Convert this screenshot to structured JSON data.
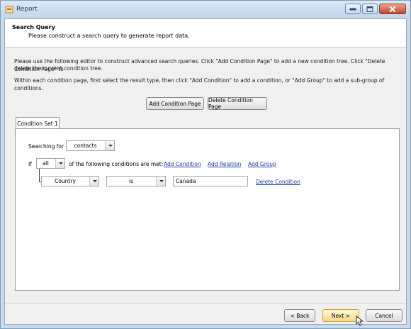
{
  "window": {
    "title": "Report",
    "colors": {
      "frame": "#c9daea",
      "close": "#c4452b",
      "link": "#1c3fa8",
      "default_button": "#f3d981"
    }
  },
  "header": {
    "title": "Search Query",
    "subtitle": "Please construct a search query to generate report data."
  },
  "instructions": {
    "line1": "Please use the following editor to construct advanced search queries.  Click \"Add Condition Page\" to add a new condition tree.  Click \"Delete Condition Page\" to",
    "line2": "delete the current condition tree.",
    "line3": "Within each condition page, first select the result type, then click \"Add Condition\" to add a condition, or \"Add Group\" to add a sub-group of conditions."
  },
  "page_buttons": {
    "add": "Add Condition Page",
    "delete": "Delete Condition Page"
  },
  "tabs": [
    {
      "label": "Condition Set 1"
    }
  ],
  "editor": {
    "searching_label": "Searching for",
    "searching_value": "contacts",
    "if_label": "If",
    "match_value": "all",
    "match_suffix": "of the following conditions are met:",
    "add_condition": "Add Condition",
    "add_relation": "Add Relation",
    "add_group": "Add Group",
    "condition": {
      "field": "Country",
      "operator": "is",
      "value": "Canada",
      "delete": "Delete Condition"
    }
  },
  "footer": {
    "back": "< Back",
    "next": "Next >",
    "cancel": "Cancel"
  }
}
